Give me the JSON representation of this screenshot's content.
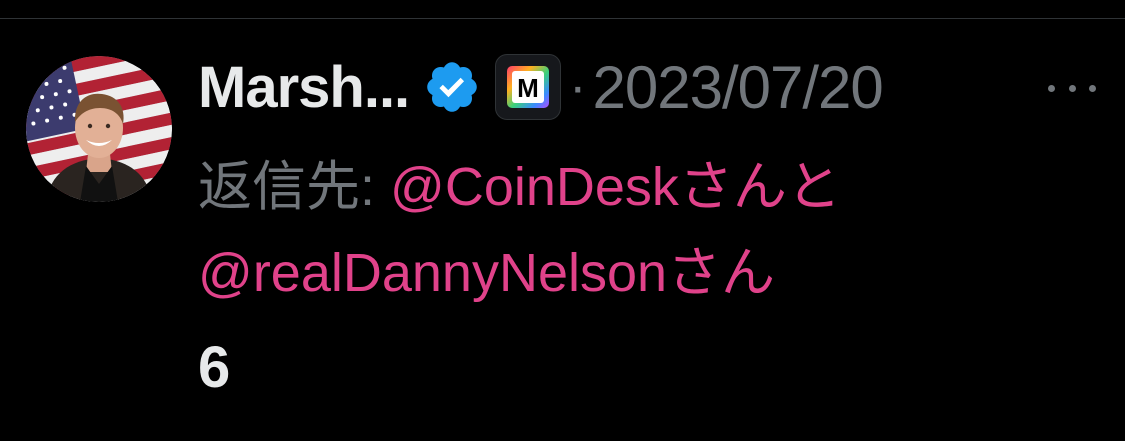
{
  "tweet": {
    "display_name": "Marsh...",
    "timestamp": "2023/07/20",
    "separator": "·",
    "verified_color": "#1d9bf0",
    "reply_label": "返信先:",
    "mention_1": "@CoinDesk",
    "mention_1_suffix": "さんと",
    "mention_2": "@realDannyNelson",
    "mention_2_suffix": "さん",
    "count": "6",
    "mention_color": "#e0428a"
  },
  "affiliate_badge": {
    "letter": "M"
  }
}
